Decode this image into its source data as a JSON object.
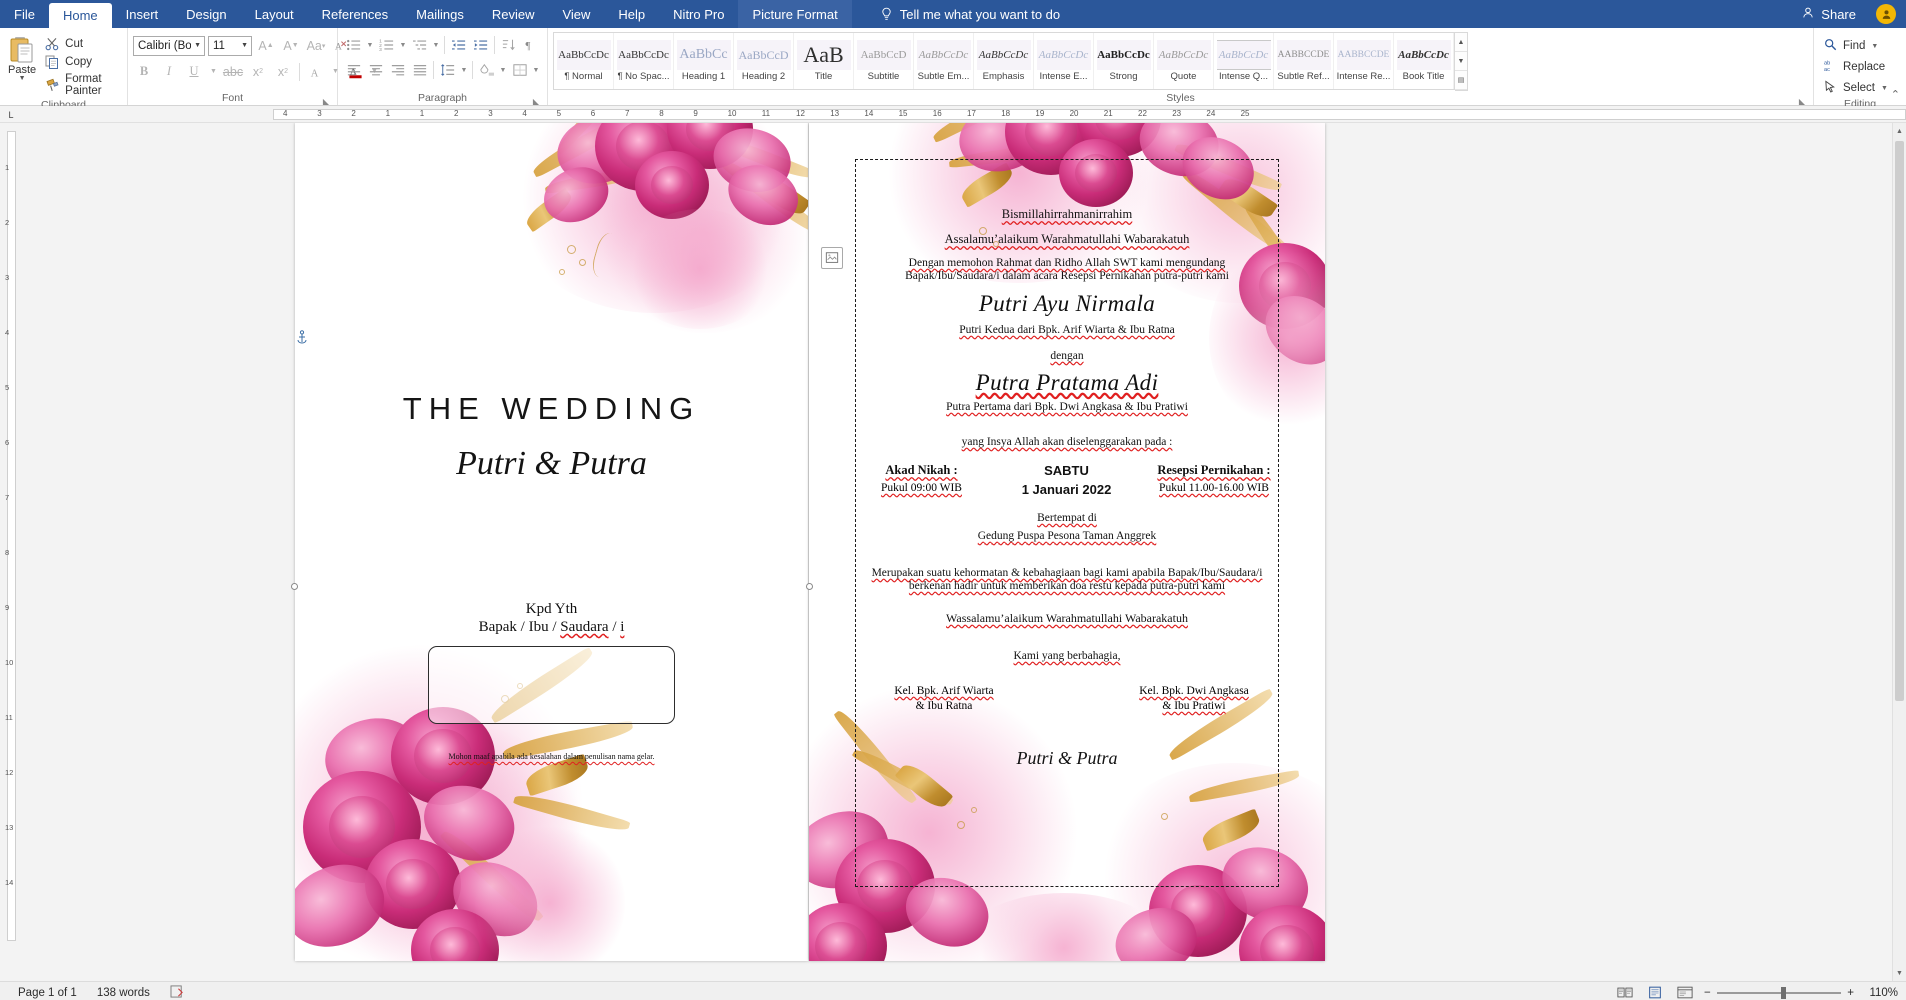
{
  "app": {
    "tabs": [
      {
        "label": "File",
        "state": "file"
      },
      {
        "label": "Home",
        "state": "active"
      },
      {
        "label": "Insert",
        "state": "normal"
      },
      {
        "label": "Design",
        "state": "normal"
      },
      {
        "label": "Layout",
        "state": "normal"
      },
      {
        "label": "References",
        "state": "normal"
      },
      {
        "label": "Mailings",
        "state": "normal"
      },
      {
        "label": "Review",
        "state": "normal"
      },
      {
        "label": "View",
        "state": "normal"
      },
      {
        "label": "Help",
        "state": "normal"
      },
      {
        "label": "Nitro Pro",
        "state": "normal"
      },
      {
        "label": "Picture Format",
        "state": "contextual"
      }
    ],
    "tell_me": "Tell me what you want to do",
    "share_label": "Share",
    "accent_color": "#2b579a"
  },
  "ribbon": {
    "clipboard": {
      "group_label": "Clipboard",
      "paste_label": "Paste",
      "items": [
        {
          "label": "Cut",
          "icon": "scissors-icon"
        },
        {
          "label": "Copy",
          "icon": "copy-icon"
        },
        {
          "label": "Format Painter",
          "icon": "format-painter-icon"
        }
      ]
    },
    "font": {
      "group_label": "Font",
      "font_name": "Calibri (Body",
      "font_size": "11",
      "buttons": [
        "grow-font-icon",
        "shrink-font-icon",
        "change-case-icon",
        "clear-formatting-icon",
        "bold-icon",
        "italic-icon",
        "underline-icon",
        "strikethrough-icon",
        "subscript-icon",
        "superscript-icon",
        "text-effects-icon",
        "text-highlight-icon",
        "font-color-icon"
      ]
    },
    "paragraph": {
      "group_label": "Paragraph",
      "buttons": [
        "bullets-icon",
        "numbering-icon",
        "multilevel-list-icon",
        "decrease-indent-icon",
        "increase-indent-icon",
        "sort-icon",
        "show-marks-icon",
        "align-left-icon",
        "align-center-icon",
        "align-right-icon",
        "justify-icon",
        "line-spacing-icon",
        "shading-icon",
        "borders-icon"
      ]
    },
    "styles": {
      "group_label": "Styles",
      "items": [
        {
          "preview": "AaBbCcDc",
          "label": "¶ Normal"
        },
        {
          "preview": "AaBbCcDc",
          "label": "¶ No Spac..."
        },
        {
          "preview": "AaBbCc",
          "label": "Heading 1"
        },
        {
          "preview": "AaBbCcD",
          "label": "Heading 2"
        },
        {
          "preview": "AaB",
          "label": "Title"
        },
        {
          "preview": "AaBbCcD",
          "label": "Subtitle"
        },
        {
          "preview": "AaBbCcDc",
          "label": "Subtle Em..."
        },
        {
          "preview": "AaBbCcDc",
          "label": "Emphasis"
        },
        {
          "preview": "AaBbCcDc",
          "label": "Intense E..."
        },
        {
          "preview": "AaBbCcDc",
          "label": "Strong"
        },
        {
          "preview": "AaBbCcDc",
          "label": "Quote"
        },
        {
          "preview": "AaBbCcDc",
          "label": "Intense Q..."
        },
        {
          "preview": "AABBCCDE",
          "label": "Subtle Ref..."
        },
        {
          "preview": "AABBCCDE",
          "label": "Intense Re..."
        },
        {
          "preview": "AaBbCcDc",
          "label": "Book Title"
        }
      ]
    },
    "editing": {
      "group_label": "Editing",
      "items": [
        {
          "label": "Find",
          "icon": "search-icon",
          "caret": true
        },
        {
          "label": "Replace",
          "icon": "replace-icon",
          "caret": false
        },
        {
          "label": "Select",
          "icon": "select-icon",
          "caret": true
        }
      ]
    }
  },
  "ruler": {
    "h_ticks": [
      "4",
      "3",
      "2",
      "1",
      "1",
      "2",
      "3",
      "4",
      "5",
      "6",
      "7",
      "8",
      "9",
      "10",
      "11",
      "12",
      "13",
      "14",
      "15",
      "16",
      "17",
      "18",
      "19",
      "20",
      "21",
      "22",
      "23",
      "24",
      "25"
    ],
    "v_ticks": [
      "1",
      "2",
      "3",
      "4",
      "5",
      "6",
      "7",
      "8",
      "9",
      "10",
      "11",
      "12",
      "13",
      "14"
    ],
    "corner_icon": "tab-stop-icon"
  },
  "document": {
    "left_page": {
      "title": "THE WEDDING",
      "couple": "Putri & Putra",
      "addressee_line1": "Kpd Yth",
      "addressee_line2_parts": [
        "Bapak / Ibu / ",
        "Saudara",
        " / ",
        "i"
      ],
      "note": "Mohon maaf apabila ada kesalahan dalam penulisan nama gelar."
    },
    "right_page": {
      "basmalah": "Bismillahirrahmanirrahim",
      "greeting": "Assalamu’alaikum Warahmatullahi Wabarakatuh",
      "intro_line1": "Dengan memohon Rahmat dan Ridho Allah SWT kami mengundang",
      "intro_line2": "Bapak/Ibu/Saudara/i dalam acara Resepsi Pernikahan putra-putri kami",
      "bride_name": "Putri Ayu Nirmala",
      "bride_parents": "Putri Kedua dari Bpk. Arif Wiarta & Ibu Ratna",
      "connector": "dengan",
      "groom_name": "Putra Pratama Adi",
      "groom_parents": "Putra Pertama dari Bpk. Dwi Angkasa & Ibu Pratiwi",
      "schedule_intro": "yang Insya Allah akan diselenggarakan pada :",
      "akad_title": "Akad Nikah :",
      "akad_time": "Pukul 09:00 WIB",
      "day": "SABTU",
      "date": "1 Januari 2022",
      "resepsi_title": "Resepsi Pernikahan :",
      "resepsi_time": "Pukul 11.00-16.00 WIB",
      "venue_label": "Bertempat di",
      "venue_name": "Gedung Puspa Pesona Taman Anggrek",
      "closing_line1": "Merupakan suatu kehormatan & kebahagiaan bagi kami apabila Bapak/Ibu/Saudara/i",
      "closing_line2": "berkenan hadir untuk memberikan doa restu kepada putra-putri kami",
      "farewell": "Wassalamu’alaikum Warahmatullahi Wabarakatuh",
      "regards": "Kami yang berbahagia,",
      "family_left_line1": "Kel. Bpk. Arif Wiarta",
      "family_left_line2": "& Ibu Ratna",
      "family_right_line1": "Kel. Bpk. Dwi Angkasa",
      "family_right_line2": "& Ibu Pratiwi",
      "footer_script": "Putri & Putra"
    }
  },
  "status": {
    "page": "Page 1 of 1",
    "words": "138 words",
    "proofing_icon": "proofing-icon",
    "views": [
      "read-mode-icon",
      "print-layout-icon",
      "web-layout-icon"
    ],
    "zoom_out": "−",
    "zoom_in": "+",
    "zoom_level": "110%"
  }
}
